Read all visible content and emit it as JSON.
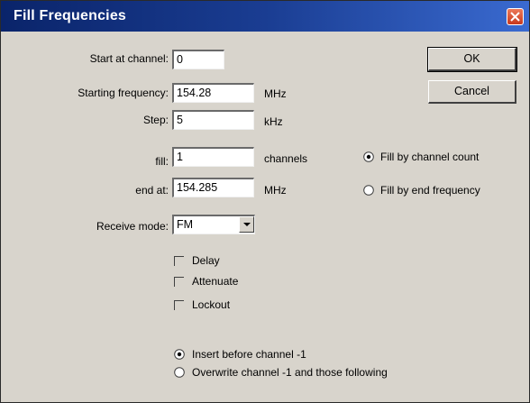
{
  "window": {
    "title": "Fill Frequencies"
  },
  "fields": {
    "start_channel": {
      "label": "Start at channel:",
      "value": "0"
    },
    "starting_frequency": {
      "label": "Starting frequency:",
      "value": "154.28",
      "unit": "MHz"
    },
    "step": {
      "label": "Step:",
      "value": "5",
      "unit": "kHz"
    },
    "fill": {
      "label": "fill:",
      "value": "1",
      "unit": "channels"
    },
    "end_at": {
      "label": "end at:",
      "value": "154.285",
      "unit": "MHz"
    }
  },
  "buttons": {
    "ok": "OK",
    "cancel": "Cancel"
  },
  "fill_mode": {
    "by_count": {
      "label": "Fill by channel count",
      "selected": true
    },
    "by_end": {
      "label": "Fill by end frequency",
      "selected": false
    }
  },
  "receive_mode": {
    "label": "Receive mode:",
    "value": "FM"
  },
  "options": {
    "delay": {
      "label": "Delay",
      "checked": false
    },
    "attenuate": {
      "label": "Attenuate",
      "checked": false
    },
    "lockout": {
      "label": "Lockout",
      "checked": false
    }
  },
  "insert_mode": {
    "insert": {
      "label": "Insert before channel -1",
      "selected": true
    },
    "overwrite": {
      "label": "Overwrite channel -1 and those following",
      "selected": false
    }
  },
  "colors": {
    "title_bar": "#0a246a",
    "dialog_bg": "#d8d4cc",
    "close_button": "#c8381c"
  }
}
